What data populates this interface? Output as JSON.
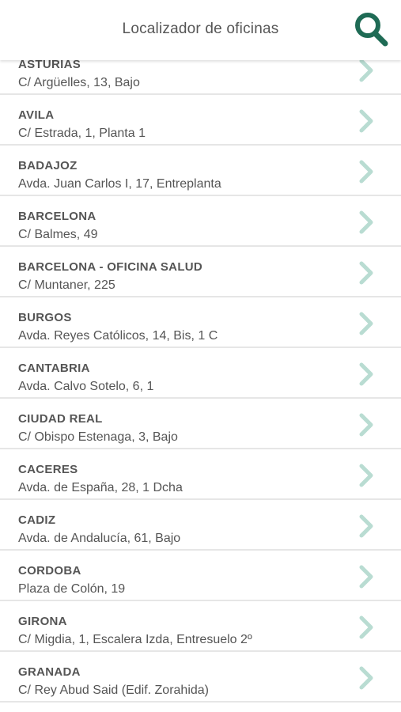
{
  "header": {
    "title": "Localizador de oficinas",
    "search_icon": "search-icon",
    "accent_color": "#1f6b55"
  },
  "offices": [
    {
      "name": "ASTURIAS",
      "address": "C/ Argüelles, 13, Bajo"
    },
    {
      "name": "AVILA",
      "address": "C/ Estrada, 1, Planta 1"
    },
    {
      "name": "BADAJOZ",
      "address": "Avda. Juan Carlos I, 17, Entreplanta"
    },
    {
      "name": "BARCELONA",
      "address": "C/ Balmes, 49"
    },
    {
      "name": "BARCELONA - OFICINA SALUD",
      "address": "C/ Muntaner, 225"
    },
    {
      "name": "BURGOS",
      "address": "Avda. Reyes Católicos, 14, Bis, 1 C"
    },
    {
      "name": "CANTABRIA",
      "address": "Avda. Calvo Sotelo, 6, 1"
    },
    {
      "name": "CIUDAD REAL",
      "address": "C/ Obispo Estenaga, 3, Bajo"
    },
    {
      "name": "CACERES",
      "address": "Avda. de España, 28, 1 Dcha"
    },
    {
      "name": "CADIZ",
      "address": "Avda. de Andalucía, 61, Bajo"
    },
    {
      "name": "CORDOBA",
      "address": "Plaza de Colón, 19"
    },
    {
      "name": "GIRONA",
      "address": "C/ Migdia, 1, Escalera Izda, Entresuelo 2º"
    },
    {
      "name": "GRANADA",
      "address": "C/ Rey Abud Said (Edif. Zorahida)"
    }
  ],
  "row_icon": "chevron-right-icon",
  "chevron_color": "#b9dcd2"
}
